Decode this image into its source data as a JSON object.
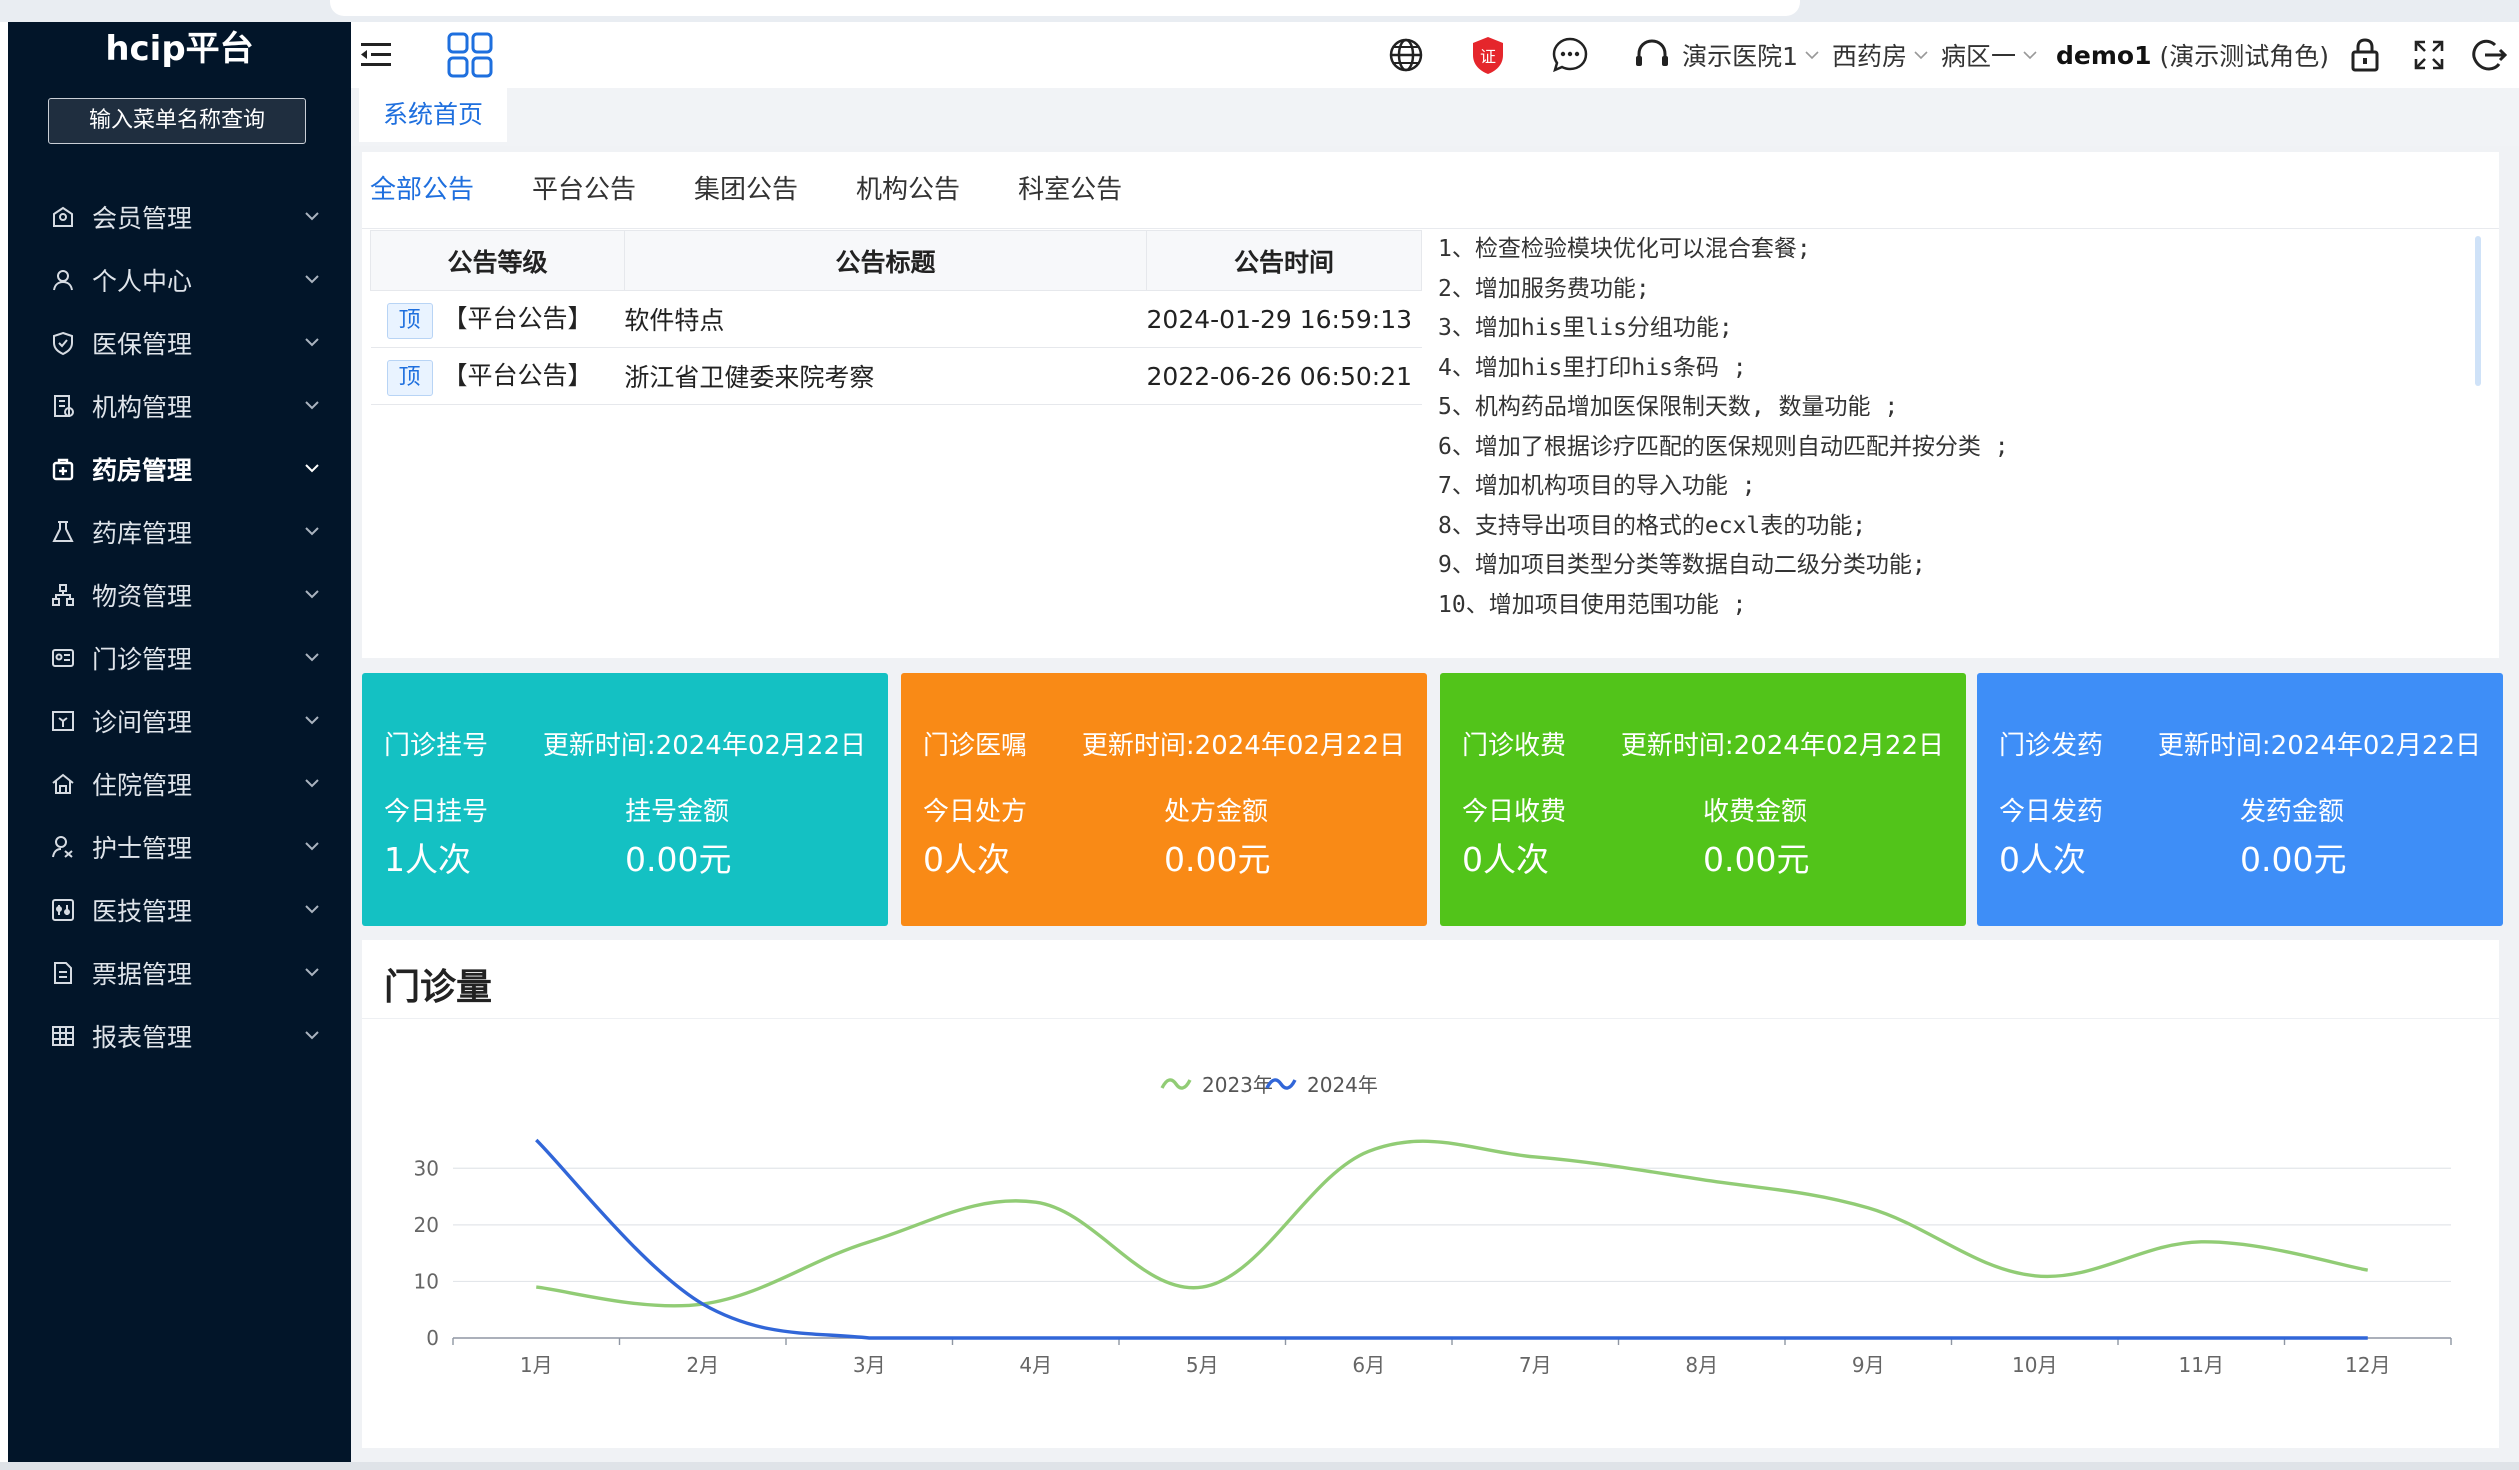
{
  "app": {
    "title": "hcip平台"
  },
  "sidebar": {
    "search_label": "输入菜单名称查询",
    "items": [
      {
        "label": "会员管理",
        "icon": "member-icon"
      },
      {
        "label": "个人中心",
        "icon": "user-icon"
      },
      {
        "label": "医保管理",
        "icon": "shield-icon"
      },
      {
        "label": "机构管理",
        "icon": "org-icon"
      },
      {
        "label": "药房管理",
        "icon": "pharmacy-icon",
        "active": true
      },
      {
        "label": "药库管理",
        "icon": "flask-icon"
      },
      {
        "label": "物资管理",
        "icon": "hierarchy-icon"
      },
      {
        "label": "门诊管理",
        "icon": "id-card-icon"
      },
      {
        "label": "诊间管理",
        "icon": "clinic-icon"
      },
      {
        "label": "住院管理",
        "icon": "home-icon"
      },
      {
        "label": "护士管理",
        "icon": "nurse-icon"
      },
      {
        "label": "医技管理",
        "icon": "tech-icon"
      },
      {
        "label": "票据管理",
        "icon": "document-icon"
      },
      {
        "label": "报表管理",
        "icon": "table-icon"
      }
    ]
  },
  "header": {
    "hospital": "演示医院1",
    "pharmacy": "西药房",
    "ward": "病区一",
    "user": "demo1",
    "role": "(演示测试角色)",
    "badge_char": "证"
  },
  "tabs": {
    "home": "系统首页"
  },
  "notices": {
    "tabs": [
      "全部公告",
      "平台公告",
      "集团公告",
      "机构公告",
      "科室公告"
    ],
    "columns": [
      "公告等级",
      "公告标题",
      "公告时间"
    ],
    "rows": [
      {
        "badge": "顶",
        "level": "【平台公告】",
        "title": "软件特点",
        "time": "2024-01-29 16:59:13"
      },
      {
        "badge": "顶",
        "level": "【平台公告】",
        "title": "浙江省卫健委来院考察",
        "time": "2022-06-26 06:50:21"
      }
    ],
    "changelog": [
      "1、检查检验模块优化可以混合套餐;",
      "2、增加服务费功能;",
      "3、增加his里lis分组功能;",
      "4、增加his里打印his条码  ;",
      "5、机构药品增加医保限制天数, 数量功能 ;",
      "6、增加了根据诊疗匹配的医保规则自动匹配并按分类 ;",
      "7、增加机构项目的导入功能 ;",
      "8、支持导出项目的格式的ecxl表的功能;",
      "9、增加项目类型分类等数据自动二级分类功能;",
      "10、增加项目使用范围功能 ;"
    ]
  },
  "stats": [
    {
      "title": "门诊挂号",
      "updated": "更新时间:2024年02月22日",
      "label1": "今日挂号",
      "value1": "1人次",
      "label2": "挂号金额",
      "value2": "0.00元",
      "color": "#14c1c3"
    },
    {
      "title": "门诊医嘱",
      "updated": "更新时间:2024年02月22日",
      "label1": "今日处方",
      "value1": "0人次",
      "label2": "处方金额",
      "value2": "0.00元",
      "color": "#f98a16"
    },
    {
      "title": "门诊收费",
      "updated": "更新时间:2024年02月22日",
      "label1": "今日收费",
      "value1": "0人次",
      "label2": "收费金额",
      "value2": "0.00元",
      "color": "#52c41a"
    },
    {
      "title": "门诊发药",
      "updated": "更新时间:2024年02月22日",
      "label1": "今日发药",
      "value1": "0人次",
      "label2": "发药金额",
      "value2": "0.00元",
      "color": "#3e8ef7"
    }
  ],
  "chart": {
    "title": "门诊量"
  },
  "chart_data": {
    "type": "line",
    "title": "门诊量",
    "categories": [
      "1月",
      "2月",
      "3月",
      "4月",
      "5月",
      "6月",
      "7月",
      "8月",
      "9月",
      "10月",
      "11月",
      "12月"
    ],
    "series": [
      {
        "name": "2023年",
        "color": "#91cc75",
        "values": [
          9,
          6,
          17,
          24,
          9,
          33,
          32,
          28,
          23,
          11,
          17,
          12
        ]
      },
      {
        "name": "2024年",
        "color": "#3166d8",
        "values": [
          35,
          6,
          0,
          0,
          0,
          0,
          0,
          0,
          0,
          0,
          0,
          0
        ]
      }
    ],
    "yticks": [
      0,
      10,
      20,
      30
    ],
    "ylim": [
      0,
      35
    ],
    "legend": "top-center",
    "grid": true,
    "smooth": true
  }
}
